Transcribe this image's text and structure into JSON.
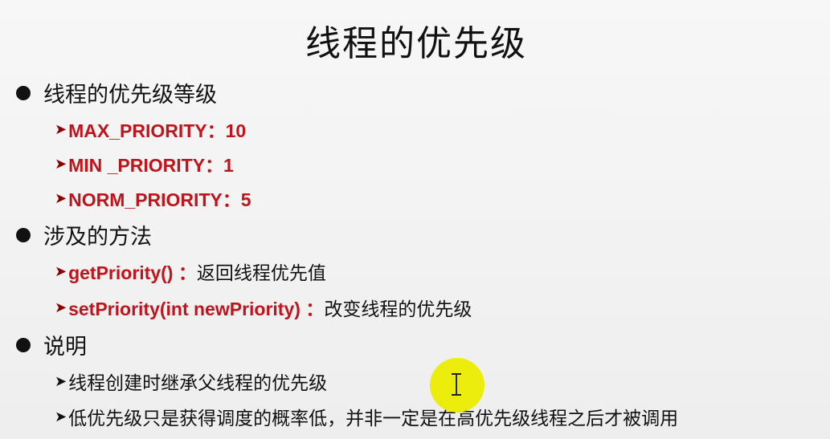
{
  "title": "线程的优先级",
  "sections": [
    {
      "heading": "线程的优先级等级",
      "items": [
        {
          "code": "MAX_PRIORITY：10",
          "text": ""
        },
        {
          "code": "MIN _PRIORITY：1",
          "text": ""
        },
        {
          "code": "NORM_PRIORITY：5",
          "text": ""
        }
      ]
    },
    {
      "heading": "涉及的方法",
      "items": [
        {
          "code": "getPriority() ：",
          "text": "返回线程优先值"
        },
        {
          "code": "setPriority(int newPriority) ：",
          "text": "改变线程的优先级"
        }
      ]
    },
    {
      "heading": "说明",
      "items": [
        {
          "code": "",
          "text": "线程创建时继承父线程的优先级"
        },
        {
          "code": "",
          "text": "低优先级只是获得调度的概率低，并非一定是在高优先级线程之后才被调用"
        }
      ]
    }
  ],
  "icons": {
    "bullet": "filled-circle-bullet",
    "arrow": "arrowhead-bullet",
    "cursor": "text-cursor-icon"
  },
  "colors": {
    "code": "#c0141c",
    "text": "#111111",
    "cursor_highlight": "#ecec00"
  }
}
